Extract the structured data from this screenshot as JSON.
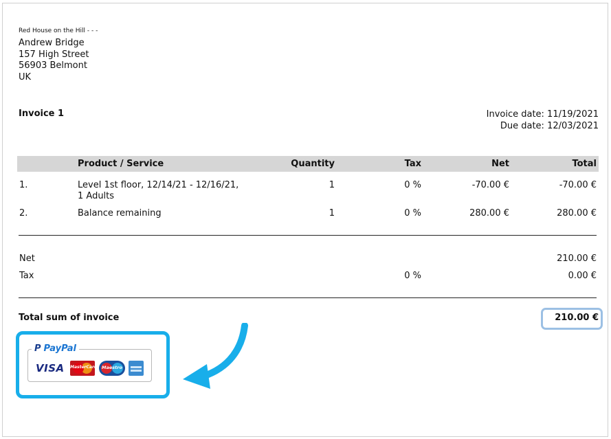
{
  "sender": {
    "line": "Red House on the Hill - - -"
  },
  "recipient": {
    "name": "Andrew Bridge",
    "street": "157 High Street",
    "city": "56903 Belmont",
    "country": "UK"
  },
  "invoice": {
    "title": "Invoice 1",
    "invoice_date": "Invoice date: 11/19/2021",
    "due_date": "Due date: 12/03/2021"
  },
  "table": {
    "headers": {
      "product": "Product / Service",
      "quantity": "Quantity",
      "tax": "Tax",
      "net": "Net",
      "total": "Total"
    },
    "rows": [
      {
        "num": "1.",
        "product_line1": "Level 1st floor, 12/14/21 - 12/16/21,",
        "product_line2": "1 Adults",
        "quantity": "1",
        "tax": "0 %",
        "net": "-70.00 €",
        "total": "-70.00 €"
      },
      {
        "num": "2.",
        "product_line1": "Balance remaining",
        "product_line2": "",
        "quantity": "1",
        "tax": "0 %",
        "net": "280.00 €",
        "total": "280.00 €"
      }
    ]
  },
  "summary": {
    "net_label": "Net",
    "net_value": "210.00 €",
    "tax_label": "Tax",
    "tax_rate": "0 %",
    "tax_value": "0.00 €",
    "total_label": "Total sum of invoice",
    "total_value": "210.00 €"
  },
  "payment": {
    "brand": "PayPal",
    "cards": [
      "VISA",
      "MasterCard",
      "Maestro",
      "American Express"
    ],
    "mastercard_text": "MasterCard",
    "maestro_text": "Maestro",
    "visa_text": "VISA"
  },
  "colors": {
    "highlight_blue": "#18aeea",
    "total_box_blue": "#9cc0e4",
    "header_gray": "#d6d6d6",
    "paypal_blue": "#1a75d2"
  }
}
